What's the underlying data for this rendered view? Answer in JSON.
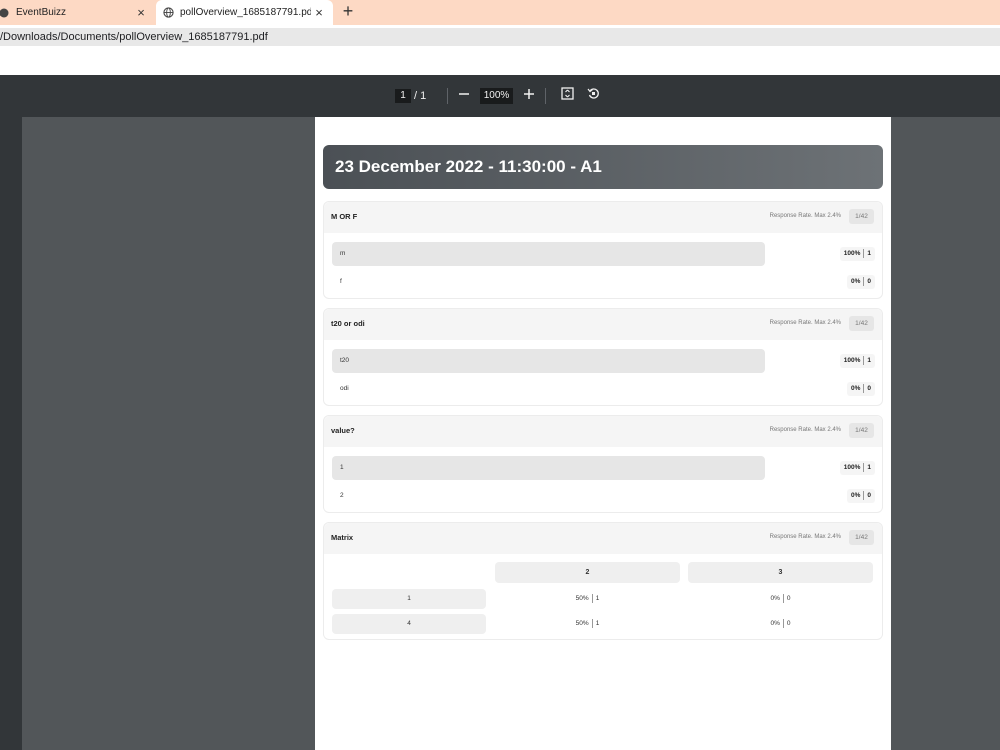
{
  "browser": {
    "tabs": [
      {
        "title": "EventBuizz",
        "close": "×"
      },
      {
        "title": "pollOverview_1685187791.pdf",
        "close": "×"
      }
    ],
    "new_tab": "+",
    "url": "/Downloads/Documents/pollOverview_1685187791.pdf"
  },
  "pdf_toolbar": {
    "current_page": "1",
    "page_sep": "/ 1",
    "zoom": "100%"
  },
  "document": {
    "title": "23 December 2022 - 11:30:00 - A1",
    "questions": [
      {
        "title": "M OR F",
        "response_rate": "Response Rate. Max 2.4%",
        "count": "1/42",
        "options": [
          {
            "label": "m",
            "percent": "100%",
            "votes": "1",
            "fill": 1.0
          },
          {
            "label": "f",
            "percent": "0%",
            "votes": "0",
            "fill": 0
          }
        ]
      },
      {
        "title": "t20 or odi",
        "response_rate": "Response Rate. Max 2.4%",
        "count": "1/42",
        "options": [
          {
            "label": "t20",
            "percent": "100%",
            "votes": "1",
            "fill": 1.0
          },
          {
            "label": "odi",
            "percent": "0%",
            "votes": "0",
            "fill": 0
          }
        ]
      },
      {
        "title": "value?",
        "response_rate": "Response Rate. Max 2.4%",
        "count": "1/42",
        "options": [
          {
            "label": "1",
            "percent": "100%",
            "votes": "1",
            "fill": 1.0
          },
          {
            "label": "2",
            "percent": "0%",
            "votes": "0",
            "fill": 0
          }
        ]
      }
    ],
    "matrix": {
      "title": "Matrix",
      "response_rate": "Response Rate. Max 2.4%",
      "count": "1/42",
      "columns": [
        "2",
        "3"
      ],
      "rows": [
        {
          "label": "1",
          "cells": [
            {
              "percent": "50%",
              "votes": "1"
            },
            {
              "percent": "0%",
              "votes": "0"
            }
          ]
        },
        {
          "label": "4",
          "cells": [
            {
              "percent": "50%",
              "votes": "1"
            },
            {
              "percent": "0%",
              "votes": "0"
            }
          ]
        }
      ]
    }
  }
}
